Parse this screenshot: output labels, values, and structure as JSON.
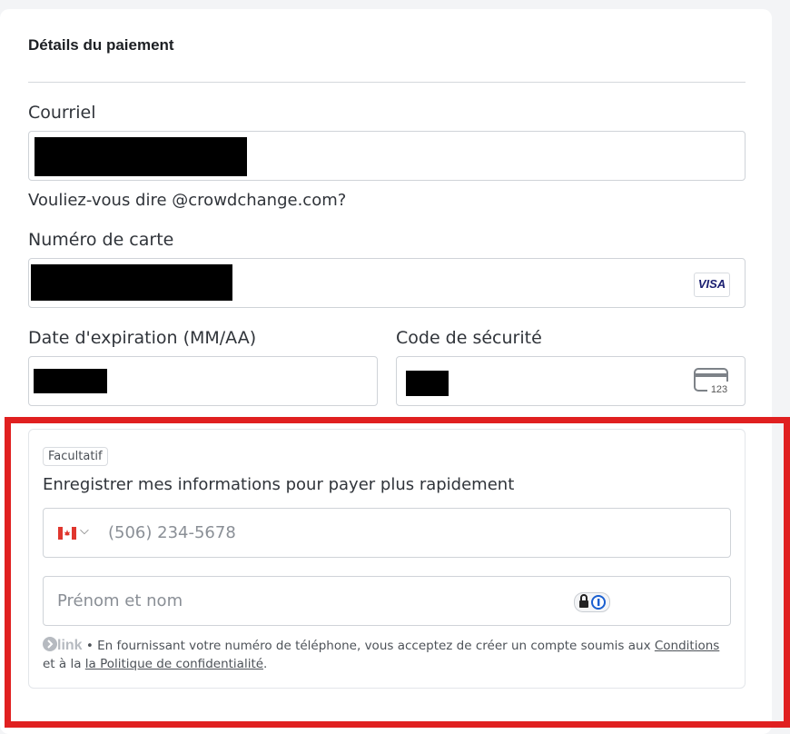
{
  "header": {
    "title": "Détails du paiement"
  },
  "email": {
    "label": "Courriel",
    "suggestion": "Vouliez-vous dire @crowdchange.com?"
  },
  "card": {
    "number_label": "Numéro de carte",
    "brand": "VISA",
    "expiry_label": "Date d'expiration (MM/AA)",
    "cvc_label": "Code de sécurité",
    "cvc_icon_text": "123"
  },
  "link": {
    "badge": "Facultatif",
    "save_text": "Enregistrer mes informations pour payer plus rapidement",
    "phone_placeholder": "(506) 234-5678",
    "name_placeholder": "Prénom et nom",
    "logo_text": "link",
    "footer_pre": " • En fournissant votre numéro de téléphone, vous acceptez de créer un compte soumis aux ",
    "conditions": "Conditions",
    "footer_mid": " et à la ",
    "privacy": "la Politique de confidentialité",
    "footer_end": "."
  },
  "colors": {
    "highlight": "#e02020",
    "visa": "#1a1f71"
  }
}
